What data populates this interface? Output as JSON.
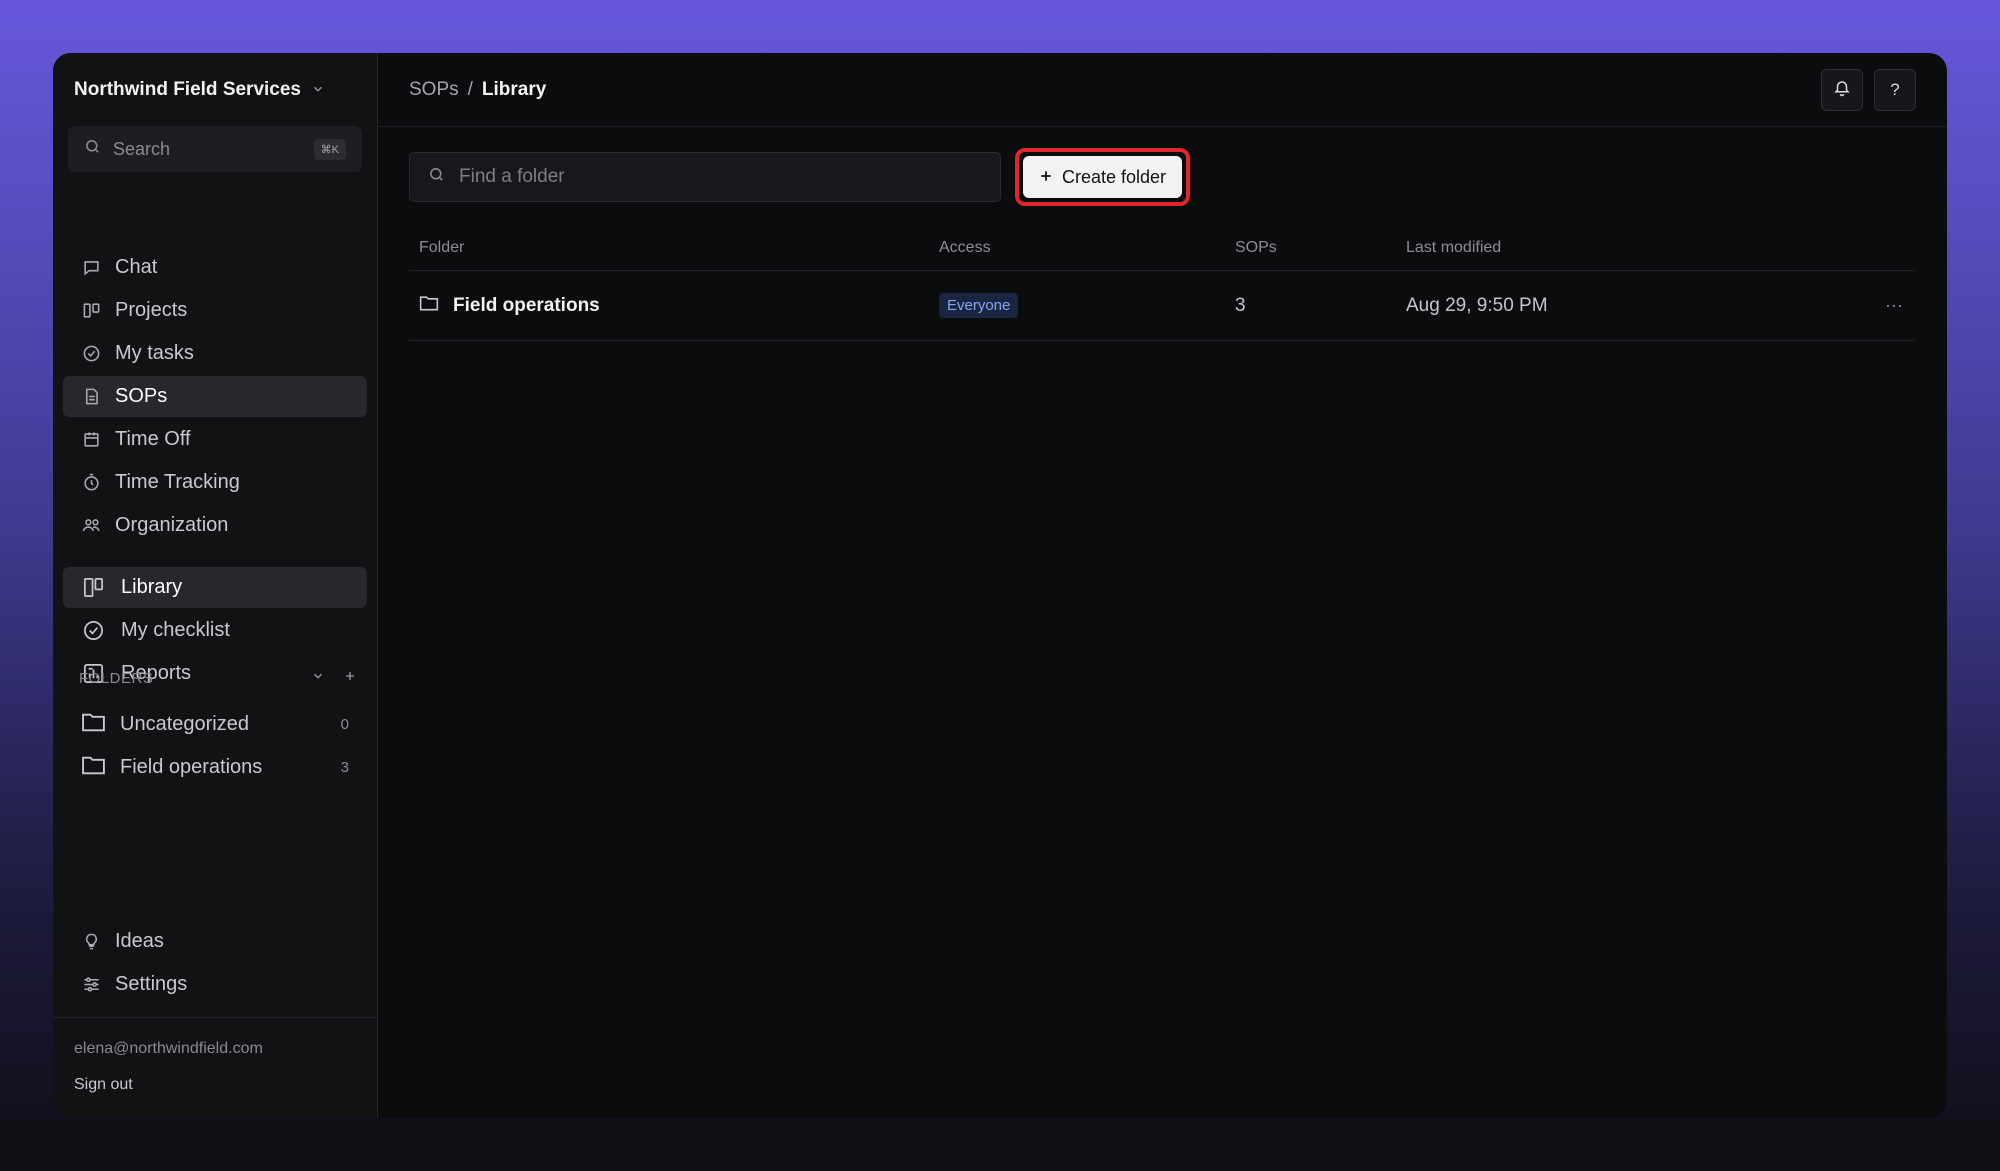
{
  "sidebar": {
    "org_name": "Northwind Field Services",
    "search_placeholder": "Search",
    "search_shortcut": "⌘K",
    "nav": [
      {
        "label": "Chat",
        "icon": "chat-icon"
      },
      {
        "label": "Projects",
        "icon": "board-icon"
      },
      {
        "label": "My tasks",
        "icon": "check-circle-icon"
      },
      {
        "label": "SOPs",
        "icon": "document-icon",
        "active": true
      },
      {
        "label": "Time Off",
        "icon": "calendar-icon"
      },
      {
        "label": "Time Tracking",
        "icon": "stopwatch-icon"
      },
      {
        "label": "Organization",
        "icon": "people-icon"
      }
    ],
    "sub_nav": [
      {
        "label": "Library",
        "icon": "board-icon",
        "active": true
      },
      {
        "label": "My checklist",
        "icon": "check-circle-icon"
      },
      {
        "label": "Reports",
        "icon": "report-icon"
      }
    ],
    "folders_heading": "FOLDERS",
    "folders": [
      {
        "name": "Uncategorized",
        "count": "0"
      },
      {
        "name": "Field operations",
        "count": "3"
      }
    ],
    "bottom_nav": [
      {
        "label": "Ideas",
        "icon": "lightbulb-icon"
      },
      {
        "label": "Settings",
        "icon": "sliders-icon"
      }
    ],
    "account_email": "elena@northwindfield.com",
    "sign_out": "Sign out"
  },
  "header": {
    "breadcrumb_parent": "SOPs",
    "breadcrumb_separator": "/",
    "breadcrumb_current": "Library",
    "help_label": "?"
  },
  "toolbar": {
    "find_placeholder": "Find a folder",
    "create_label": "Create folder"
  },
  "table": {
    "columns": [
      "Folder",
      "Access",
      "SOPs",
      "Last modified"
    ],
    "rows": [
      {
        "folder": "Field operations",
        "access": "Everyone",
        "sops": "3",
        "modified": "Aug 29, 9:50 PM",
        "more": "···"
      }
    ]
  },
  "colors": {
    "highlight": "#e0262b",
    "badge_text": "#86a6ef",
    "badge_bg": "#1a2540"
  }
}
